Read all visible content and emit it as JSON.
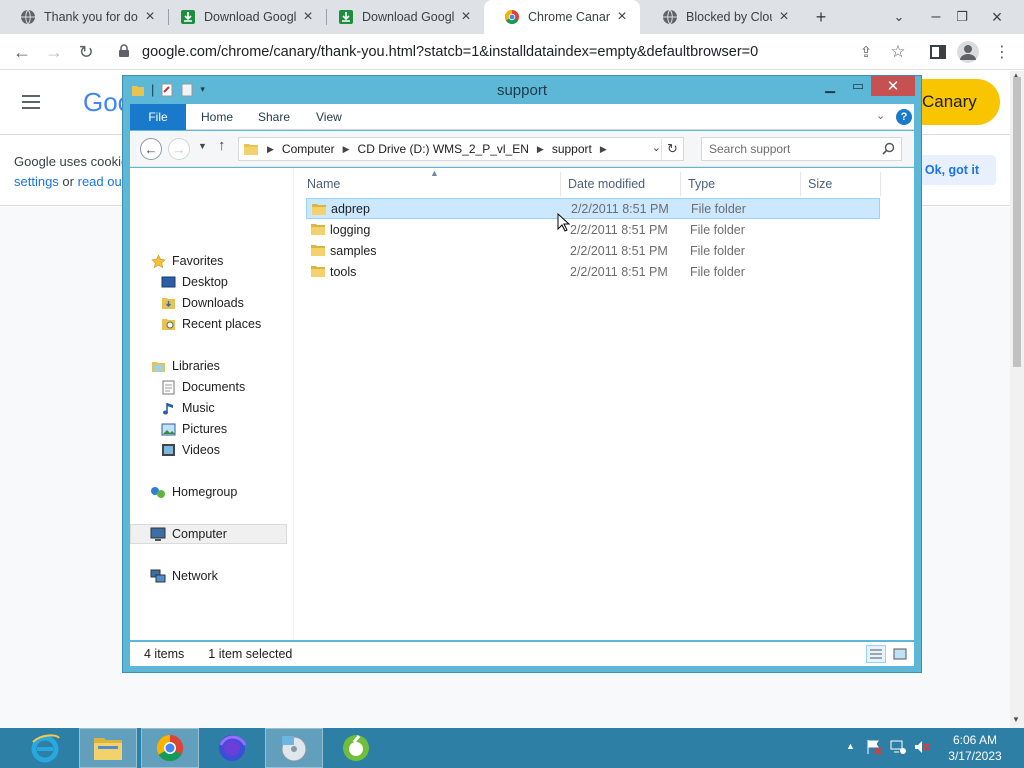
{
  "browser": {
    "tabs": [
      {
        "title": "Thank you for do",
        "icon": "chrome-globe-icon"
      },
      {
        "title": "Download Googl",
        "icon": "download-icon"
      },
      {
        "title": "Download Googl",
        "icon": "download-icon"
      },
      {
        "title": "Chrome Canary",
        "icon": "chrome-logo-icon",
        "active": true
      },
      {
        "title": "Blocked by Cloud",
        "icon": "globe-icon"
      }
    ],
    "url": "google.com/chrome/canary/thank-you.html?statcb=1&installdataindex=empty&defaultbrowser=0"
  },
  "page": {
    "logo_text": "Goo",
    "canary_button": "Canary",
    "cookie_line1": "Google uses cookie",
    "cookie_link1": "settings",
    "cookie_or": " or ",
    "cookie_link2": "read our",
    "ok_button": "Ok, got it"
  },
  "explorer": {
    "title": "support",
    "ribbon_tabs": [
      "File",
      "Home",
      "Share",
      "View"
    ],
    "breadcrumb": [
      "Computer",
      "CD Drive (D:) WMS_2_P_vl_EN",
      "support"
    ],
    "search_placeholder": "Search support",
    "nav": {
      "favorites": "Favorites",
      "desktop": "Desktop",
      "downloads": "Downloads",
      "recent": "Recent places",
      "libraries": "Libraries",
      "documents": "Documents",
      "music": "Music",
      "pictures": "Pictures",
      "videos": "Videos",
      "homegroup": "Homegroup",
      "computer": "Computer",
      "network": "Network"
    },
    "columns": {
      "name": "Name",
      "date": "Date modified",
      "type": "Type",
      "size": "Size"
    },
    "files": [
      {
        "name": "adprep",
        "date": "2/2/2011 8:51 PM",
        "type": "File folder",
        "selected": true
      },
      {
        "name": "logging",
        "date": "2/2/2011 8:51 PM",
        "type": "File folder"
      },
      {
        "name": "samples",
        "date": "2/2/2011 8:51 PM",
        "type": "File folder"
      },
      {
        "name": "tools",
        "date": "2/2/2011 8:51 PM",
        "type": "File folder"
      }
    ],
    "status_items": "4 items",
    "status_selected": "1 item selected"
  },
  "taskbar": {
    "apps": [
      "internet-explorer-icon",
      "file-explorer-icon",
      "chrome-icon",
      "firefox-icon",
      "disc-installer-icon",
      "green-app-icon"
    ],
    "time": "6:06 AM",
    "date": "3/17/2023"
  },
  "colors": {
    "window_frame": "#5db8d7",
    "selection": "#cce8ff",
    "taskbar": "#2d7fa6",
    "file_tab": "#1979ca",
    "canary_yellow": "#f9c400"
  }
}
